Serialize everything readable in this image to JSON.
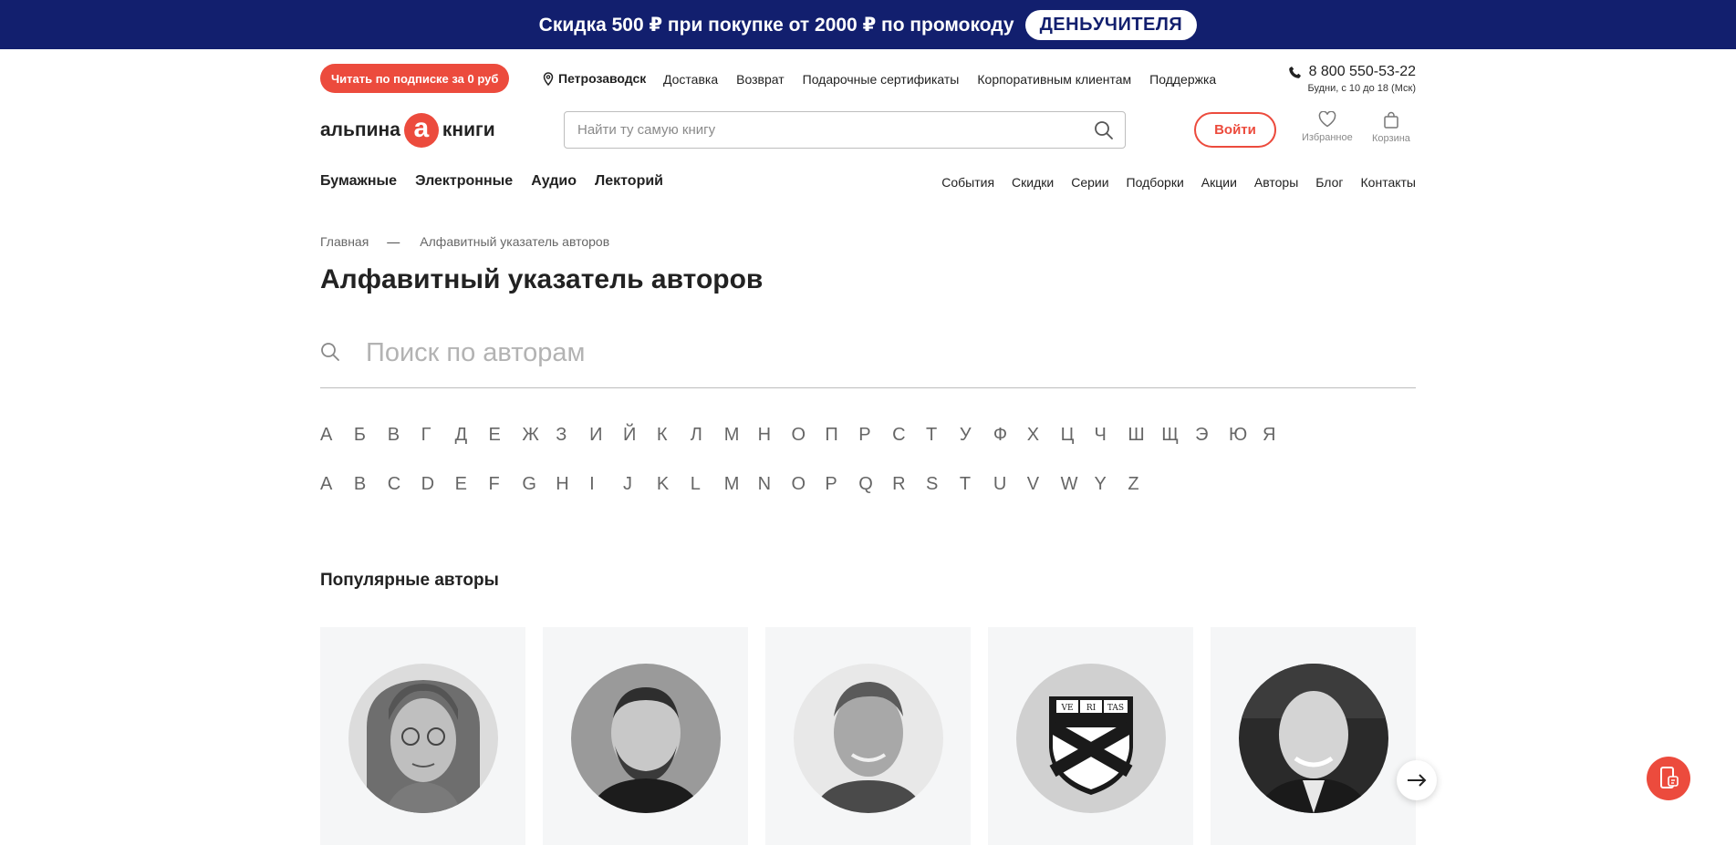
{
  "promo": {
    "text": "Скидка 500 ₽ при покупке от 2000 ₽ по промокоду",
    "code": "ДЕНЬУЧИТЕЛЯ"
  },
  "topbar": {
    "subscribe_label": "Читать по подписке за 0 руб",
    "city": "Петрозаводск",
    "links": [
      "Доставка",
      "Возврат",
      "Подарочные сертификаты",
      "Корпоративным клиентам",
      "Поддержка"
    ],
    "phone": "8 800 550-53-22",
    "hours": "Будни, с 10 до 18 (Мск)"
  },
  "header": {
    "logo_left": "альпина",
    "logo_mark": "а",
    "logo_right": "книги",
    "search_placeholder": "Найти ту самую книгу",
    "login_label": "Войти",
    "favorites_label": "Избранное",
    "cart_label": "Корзина"
  },
  "nav": {
    "main": [
      "Бумажные",
      "Электронные",
      "Аудио",
      "Лекторий"
    ],
    "secondary": [
      "События",
      "Скидки",
      "Серии",
      "Подборки",
      "Акции",
      "Авторы",
      "Блог",
      "Контакты"
    ]
  },
  "breadcrumbs": {
    "home": "Главная",
    "separator": "—",
    "current": "Алфавитный указатель авторов"
  },
  "page": {
    "title": "Алфавитный указатель авторов",
    "author_search_placeholder": "Поиск по авторам",
    "popular_heading": "Популярные авторы"
  },
  "alphabet": {
    "ru": [
      "А",
      "Б",
      "В",
      "Г",
      "Д",
      "Е",
      "Ж",
      "З",
      "И",
      "Й",
      "К",
      "Л",
      "М",
      "Н",
      "О",
      "П",
      "Р",
      "С",
      "Т",
      "У",
      "Ф",
      "Х",
      "Ц",
      "Ч",
      "Ш",
      "Щ",
      "Э",
      "Ю",
      "Я"
    ],
    "en": [
      "A",
      "B",
      "C",
      "D",
      "E",
      "F",
      "G",
      "H",
      "I",
      "J",
      "K",
      "L",
      "M",
      "N",
      "O",
      "P",
      "Q",
      "R",
      "S",
      "T",
      "U",
      "V",
      "W",
      "Y",
      "Z"
    ]
  },
  "crest": {
    "t1": "VE",
    "t2": "RI",
    "t3": "TAS"
  },
  "colors": {
    "accent": "#ec4b3d",
    "promo_bg": "#121f6e",
    "card_bg": "#f5f6f7"
  }
}
